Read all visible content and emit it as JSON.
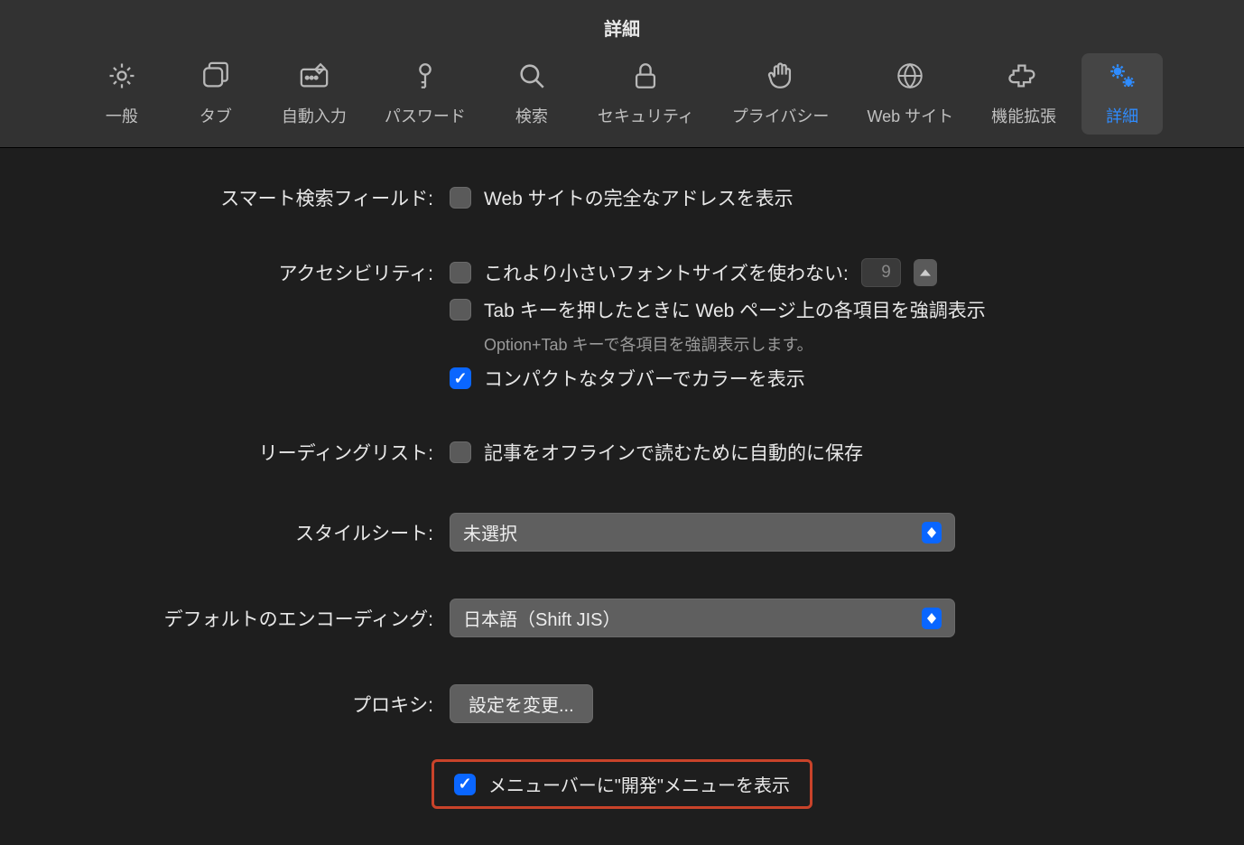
{
  "window": {
    "title": "詳細"
  },
  "tabs": {
    "general": "一般",
    "tabs_": "タブ",
    "autofill": "自動入力",
    "passwords": "パスワード",
    "search": "検索",
    "security": "セキュリティ",
    "privacy": "プライバシー",
    "websites": "Web サイト",
    "extensions": "機能拡張",
    "advanced": "詳細"
  },
  "labels": {
    "smart_search": "スマート検索フィールド:",
    "accessibility": "アクセシビリティ:",
    "reading_list": "リーディングリスト:",
    "stylesheet": "スタイルシート:",
    "encoding": "デフォルトのエンコーディング:",
    "proxy": "プロキシ:"
  },
  "options": {
    "show_full_address": "Web サイトの完全なアドレスを表示",
    "min_font_size": "これより小さいフォントサイズを使わない:",
    "font_size_value": "9",
    "tab_highlight": "Tab キーを押したときに Web ページ上の各項目を強調表示",
    "tab_hint": "Option+Tab キーで各項目を強調表示します。",
    "compact_tab_color": "コンパクトなタブバーでカラーを表示",
    "save_offline": "記事をオフラインで読むために自動的に保存",
    "stylesheet_value": "未選択",
    "encoding_value": "日本語（Shift JIS）",
    "proxy_button": "設定を変更...",
    "show_develop_menu": "メニューバーに\"開発\"メニューを表示"
  }
}
